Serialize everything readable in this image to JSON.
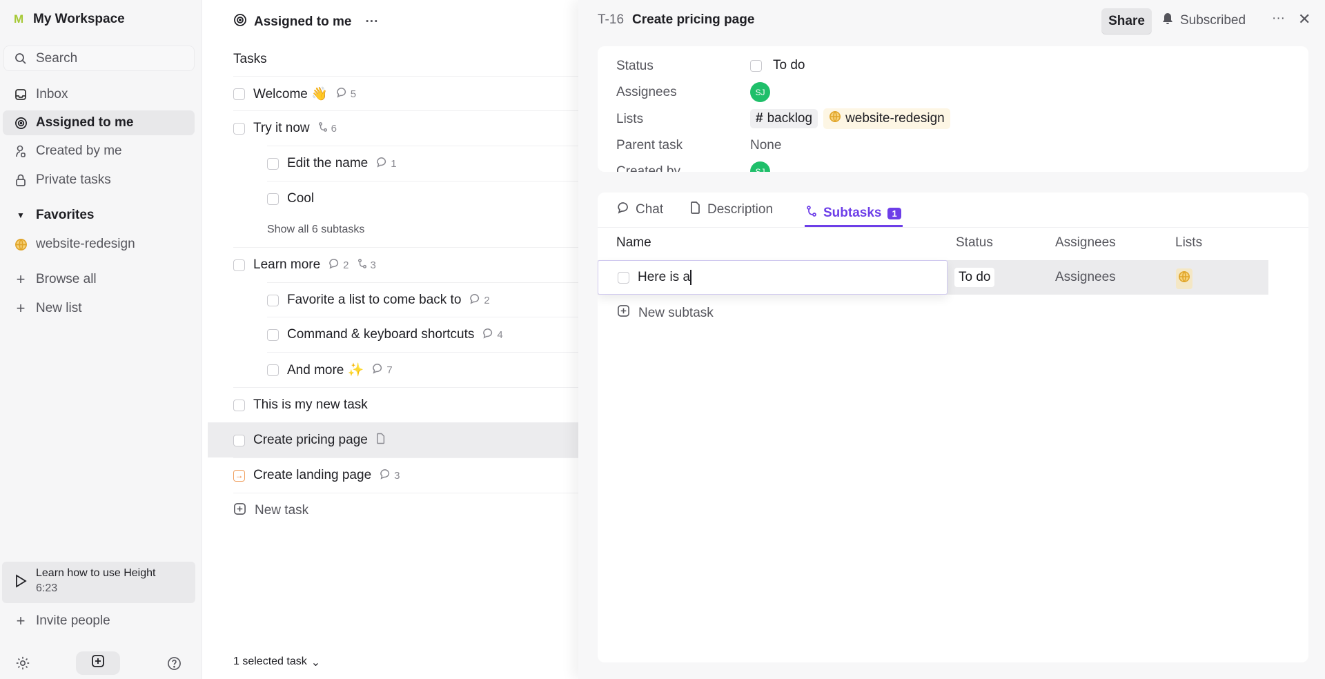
{
  "sidebar": {
    "workspace_initial": "M",
    "workspace": "My Workspace",
    "search": "Search",
    "items": [
      {
        "label": "Inbox",
        "icon": "inbox-icon"
      },
      {
        "label": "Assigned to me",
        "icon": "target-icon"
      },
      {
        "label": "Created by me",
        "icon": "user-icon"
      },
      {
        "label": "Private tasks",
        "icon": "lock-icon"
      }
    ],
    "favorites": "Favorites",
    "favorite_item": "website-redesign",
    "browse_all": "Browse all",
    "new_list": "New list",
    "learn_title": "Learn how to use Height",
    "learn_duration": "6:23",
    "invite": "Invite people"
  },
  "middle": {
    "title": "Assigned to me",
    "section": "Tasks",
    "rows": [
      {
        "name": "Welcome 👋",
        "comments": "5"
      },
      {
        "name": "Try it now",
        "subtasks": "6"
      },
      {
        "name": "Edit the name",
        "comments": "1"
      },
      {
        "name": "Cool"
      },
      {
        "name": "Learn more",
        "comments": "2",
        "subtasks": "3"
      },
      {
        "name": "Favorite a list to come back to",
        "comments": "2"
      },
      {
        "name": "Command & keyboard shortcuts",
        "comments": "4"
      },
      {
        "name": "And more ✨",
        "comments": "7"
      },
      {
        "name": "This is my new task"
      },
      {
        "name": "Create pricing page"
      },
      {
        "name": "Create landing page",
        "comments": "3"
      }
    ],
    "show_all": "Show all 6 subtasks",
    "new_task": "New task",
    "selected": "1 selected task"
  },
  "detail": {
    "id": "T-16",
    "title": "Create pricing page",
    "share": "Share",
    "subscribed": "Subscribed",
    "props": {
      "status_label": "Status",
      "status": "To do",
      "assignees_label": "Assignees",
      "assignee_initials": "SJ",
      "lists_label": "Lists",
      "list1": "backlog",
      "list2": "website-redesign",
      "parent_label": "Parent task",
      "parent": "None",
      "created_label": "Created by",
      "creator_initials": "SJ"
    },
    "tabs": {
      "chat": "Chat",
      "description": "Description",
      "subtasks": "Subtasks",
      "subtasks_count": "1"
    },
    "table": {
      "name": "Name",
      "status": "Status",
      "assignees": "Assignees",
      "lists": "Lists"
    },
    "subtask": {
      "name_value": "Here is a",
      "status": "To do",
      "assignees": "Assignees"
    },
    "new_subtask": "New subtask",
    "accent": "#6d3ee8"
  }
}
